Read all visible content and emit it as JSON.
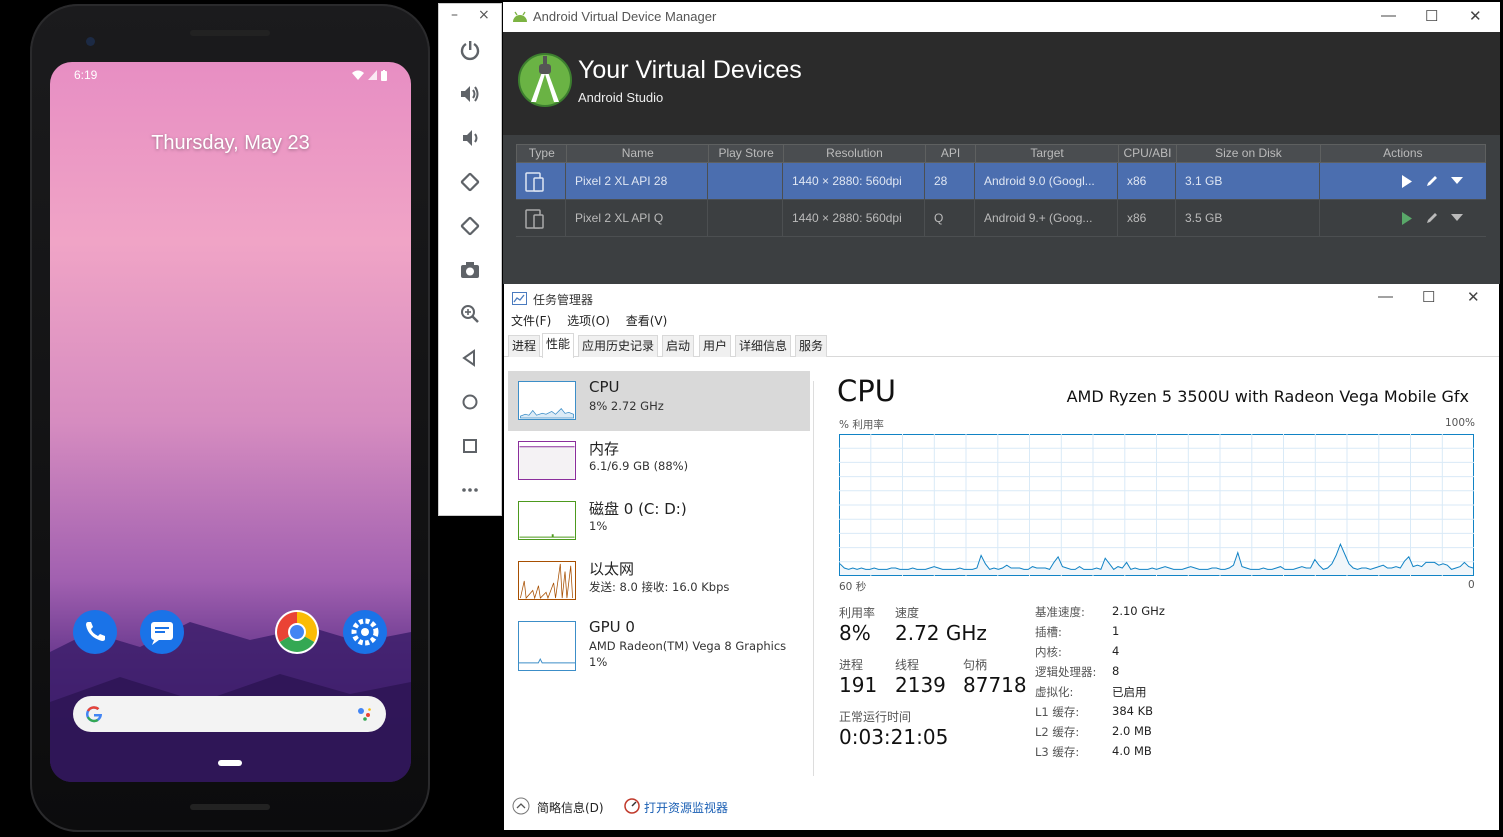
{
  "phone": {
    "time": "6:19",
    "date": "Thursday, May 23",
    "apps": [
      "phone-icon",
      "messages-icon",
      "chrome-icon",
      "settings-icon"
    ]
  },
  "emulator": {
    "minimize": "–",
    "close": "×",
    "buttons": [
      "power-icon",
      "volume-up-icon",
      "volume-down-icon",
      "rotate-left-icon",
      "rotate-right-icon",
      "camera-icon",
      "zoom-icon",
      "back-icon",
      "home-icon",
      "overview-icon",
      "more-icon"
    ]
  },
  "avd": {
    "window_title": "Android Virtual Device Manager",
    "heading": "Your Virtual Devices",
    "subheading": "Android Studio",
    "columns": [
      "Type",
      "Name",
      "Play Store",
      "Resolution",
      "API",
      "Target",
      "CPU/ABI",
      "Size on Disk",
      "Actions"
    ],
    "rows": [
      {
        "name": "Pixel 2 XL API 28",
        "play_store": "",
        "resolution": "1440 × 2880: 560dpi",
        "api": "28",
        "target": "Android 9.0 (Googl...",
        "cpu": "x86",
        "size": "3.1 GB",
        "selected": true
      },
      {
        "name": "Pixel 2 XL API Q",
        "play_store": "",
        "resolution": "1440 × 2880: 560dpi",
        "api": "Q",
        "target": "Android 9.+ (Goog...",
        "cpu": "x86",
        "size": "3.5 GB",
        "selected": false
      }
    ],
    "colors": {
      "accent": "#4b6eaf",
      "play_green": "#59a869",
      "banner": "#2b2b2b"
    }
  },
  "tm": {
    "window_title": "任务管理器",
    "menu": [
      "文件(F)",
      "选项(O)",
      "查看(V)"
    ],
    "tabs": [
      "进程",
      "性能",
      "应用历史记录",
      "启动",
      "用户",
      "详细信息",
      "服务"
    ],
    "active_tab": "性能",
    "sidebar": [
      {
        "name": "CPU",
        "sub": "8% 2.72 GHz",
        "sub2": ""
      },
      {
        "name": "内存",
        "sub": "6.1/6.9 GB (88%)",
        "sub2": ""
      },
      {
        "name": "磁盘 0 (C: D:)",
        "sub": "1%",
        "sub2": ""
      },
      {
        "name": "以太网",
        "sub": "发送: 8.0 接收: 16.0 Kbps",
        "sub2": ""
      },
      {
        "name": "GPU 0",
        "sub": "AMD Radeon(TM) Vega 8 Graphics",
        "sub2": "1%"
      }
    ],
    "panel": {
      "title": "CPU",
      "model": "AMD Ryzen 5 3500U with Radeon Vega Mobile Gfx",
      "graph_label": "% 利用率",
      "graph_max": "100%",
      "graph_time": "60 秒",
      "graph_min": "0",
      "utilization_label": "利用率",
      "utilization": "8%",
      "speed_label": "速度",
      "speed": "2.72 GHz",
      "processes_label": "进程",
      "processes": "191",
      "threads_label": "线程",
      "threads": "2139",
      "handles_label": "句柄",
      "handles": "87718",
      "uptime_label": "正常运行时间",
      "uptime": "0:03:21:05",
      "details": [
        {
          "k": "基准速度:",
          "v": "2.10 GHz"
        },
        {
          "k": "插槽:",
          "v": "1"
        },
        {
          "k": "内核:",
          "v": "4"
        },
        {
          "k": "逻辑处理器:",
          "v": "8"
        },
        {
          "k": "虚拟化:",
          "v": "已启用"
        },
        {
          "k": "L1 缓存:",
          "v": "384 KB"
        },
        {
          "k": "L2 缓存:",
          "v": "2.0 MB"
        },
        {
          "k": "L3 缓存:",
          "v": "4.0 MB"
        }
      ]
    },
    "footer": {
      "less_details": "简略信息(D)",
      "open_monitor": "打开资源监视器"
    },
    "cpu_history": [
      8,
      5,
      4,
      5,
      4,
      5,
      4,
      4,
      5,
      4,
      4,
      4,
      5,
      5,
      4,
      4,
      4,
      5,
      4,
      4,
      4,
      5,
      6,
      5,
      4,
      4,
      4,
      4,
      5,
      4,
      4,
      4,
      5,
      14,
      8,
      4,
      5,
      4,
      5,
      7,
      5,
      5,
      5,
      4,
      4,
      6,
      5,
      5,
      5,
      4,
      9,
      13,
      6,
      5,
      4,
      4,
      6,
      4,
      4,
      4,
      5,
      4,
      12,
      8,
      4,
      6,
      5,
      9,
      4,
      5,
      4,
      4,
      4,
      5,
      4,
      5,
      6,
      5,
      4,
      4,
      4,
      5,
      6,
      5,
      4,
      4,
      4,
      5,
      5,
      4,
      4,
      5,
      7,
      16,
      6,
      5,
      4,
      4,
      4,
      5,
      4,
      4,
      5,
      6,
      4,
      4,
      4,
      5,
      6,
      5,
      5,
      11,
      7,
      4,
      5,
      8,
      14,
      22,
      15,
      8,
      5,
      4,
      5,
      5,
      4,
      5,
      6,
      7,
      5,
      5,
      6,
      5,
      10,
      13,
      6,
      7,
      6,
      9,
      9,
      9,
      7,
      8,
      7,
      4,
      5,
      6,
      9,
      6,
      5
    ]
  }
}
